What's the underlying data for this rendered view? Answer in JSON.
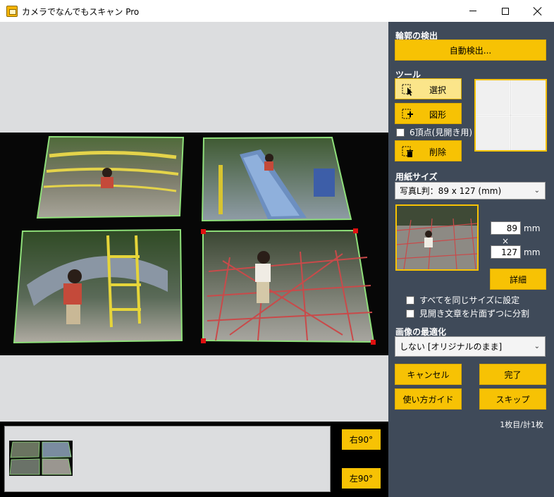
{
  "window": {
    "title": "カメラでなんでもスキャン Pro"
  },
  "colors": {
    "accent": "#f7c204",
    "panel": "#3f4a59",
    "preview_bg": "#dcdddf",
    "selection": "#8fe07a",
    "handle": "#e01010"
  },
  "detect": {
    "section_label": "輪郭の検出",
    "auto_button": "自動検出..."
  },
  "tools": {
    "section_label": "ツール",
    "select_button": "選択",
    "shape_button": "図形",
    "six_points_label": "6頂点(見開き用)",
    "delete_button": "削除",
    "icons": [
      "select-cursor-icon",
      "shape-plus-icon",
      "trash-icon"
    ]
  },
  "paper": {
    "section_label": "用紙サイズ",
    "size_value": "写真L判：89 x 127 (mm)",
    "width": "89",
    "height": "127",
    "times": "×",
    "unit": "mm",
    "detail_button": "詳細",
    "same_size_label": "すべてを同じサイズに設定",
    "split_label": "見開き文章を片面ずつに分割"
  },
  "optimize": {
    "section_label": "画像の最適化",
    "value": "しない [オリジナルのまま]"
  },
  "actions": {
    "cancel": "キャンセル",
    "done": "完了",
    "guide": "使い方ガイド",
    "skip": "スキップ"
  },
  "status": {
    "page_count": "1枚目/計1枚"
  },
  "bottom": {
    "rotate_right": "右90°",
    "rotate_left": "左90°"
  }
}
